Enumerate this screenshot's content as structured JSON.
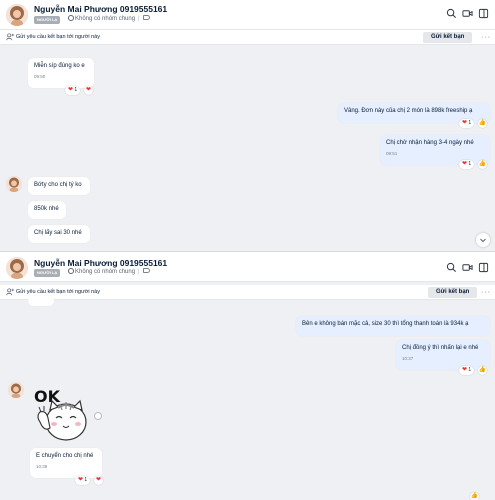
{
  "contact": {
    "name": "Nguyễn Mai Phương 0919555161",
    "badge": "NGƯỜI LẠ",
    "mutual_groups": "Không có nhóm chung"
  },
  "request_bar": {
    "text": "Gửi yêu cầu kết bạn tới người này",
    "button": "Gửi kết bạn",
    "more": "···"
  },
  "icons": {
    "search": "search-icon",
    "video": "video-call-icon",
    "sidebar": "sidebar-toggle-icon",
    "tag": "tag-icon",
    "add_friend": "add-friend-icon",
    "heart": "heart-icon",
    "thumbs_up": "thumbs-up-icon",
    "scroll_down": "chevron-down-icon",
    "share": "share-icon"
  },
  "reactions": {
    "heart": "❤",
    "thumb": "👍",
    "count": "1"
  },
  "panel1": {
    "messages": [
      {
        "text": "Miễn síp đúng ko e",
        "time": "09:50"
      },
      {
        "text": "Vâng. Đơn này của chị 2 món là 898k freeship ạ"
      },
      {
        "text": "Chị chờ nhận hàng 3-4 ngày nhé",
        "time": "09:51"
      },
      {
        "text": "Bớty cho chị tý ko"
      },
      {
        "text": "850k nhé"
      },
      {
        "text": "Chị lấy sai 30 nhé"
      }
    ]
  },
  "panel2": {
    "messages": [
      {
        "text": "Bên e không bán mặc cả, size 30 thì tổng thanh toán là 934k ạ"
      },
      {
        "text": "Chị đồng ý thì nhấn lại e nhé",
        "time": "10:37"
      },
      {
        "text": "E chuyển cho chị nhé",
        "time": "10:38"
      }
    ],
    "sticker_text": "OK"
  },
  "colors": {
    "accent": "#0068ff",
    "my_bubble": "#e5efff",
    "their_bubble": "#ffffff",
    "background": "#eef0f3",
    "heart": "#e53935"
  }
}
